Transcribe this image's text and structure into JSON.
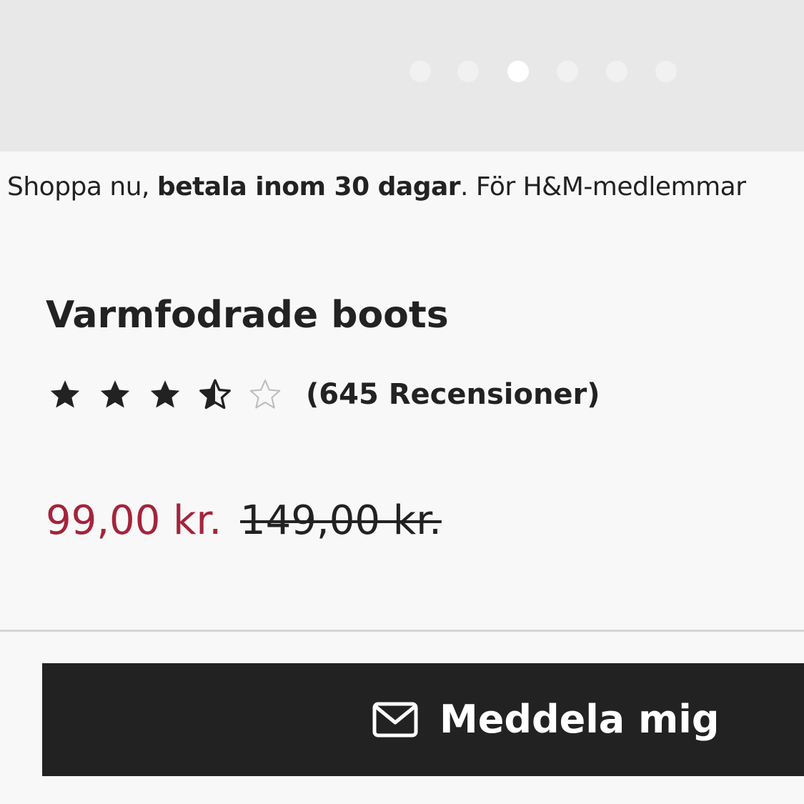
{
  "gallery": {
    "dots": 6,
    "active_index": 2
  },
  "promo": {
    "prefix": "Shoppa nu, ",
    "bold": "betala inom 30 dagar",
    "suffix": ". För H&M-medlemmar"
  },
  "product": {
    "title": "Varmfodrade boots",
    "rating": {
      "value": 3.5,
      "max": 5,
      "reviews_label": "(645 Recensioner)"
    },
    "price": {
      "sale": "99,00 kr.",
      "regular": "149,00 kr.",
      "sale_color": "#a4243b"
    }
  },
  "cta": {
    "label": "Meddela mig",
    "icon": "envelope-icon",
    "background": "#222222"
  }
}
